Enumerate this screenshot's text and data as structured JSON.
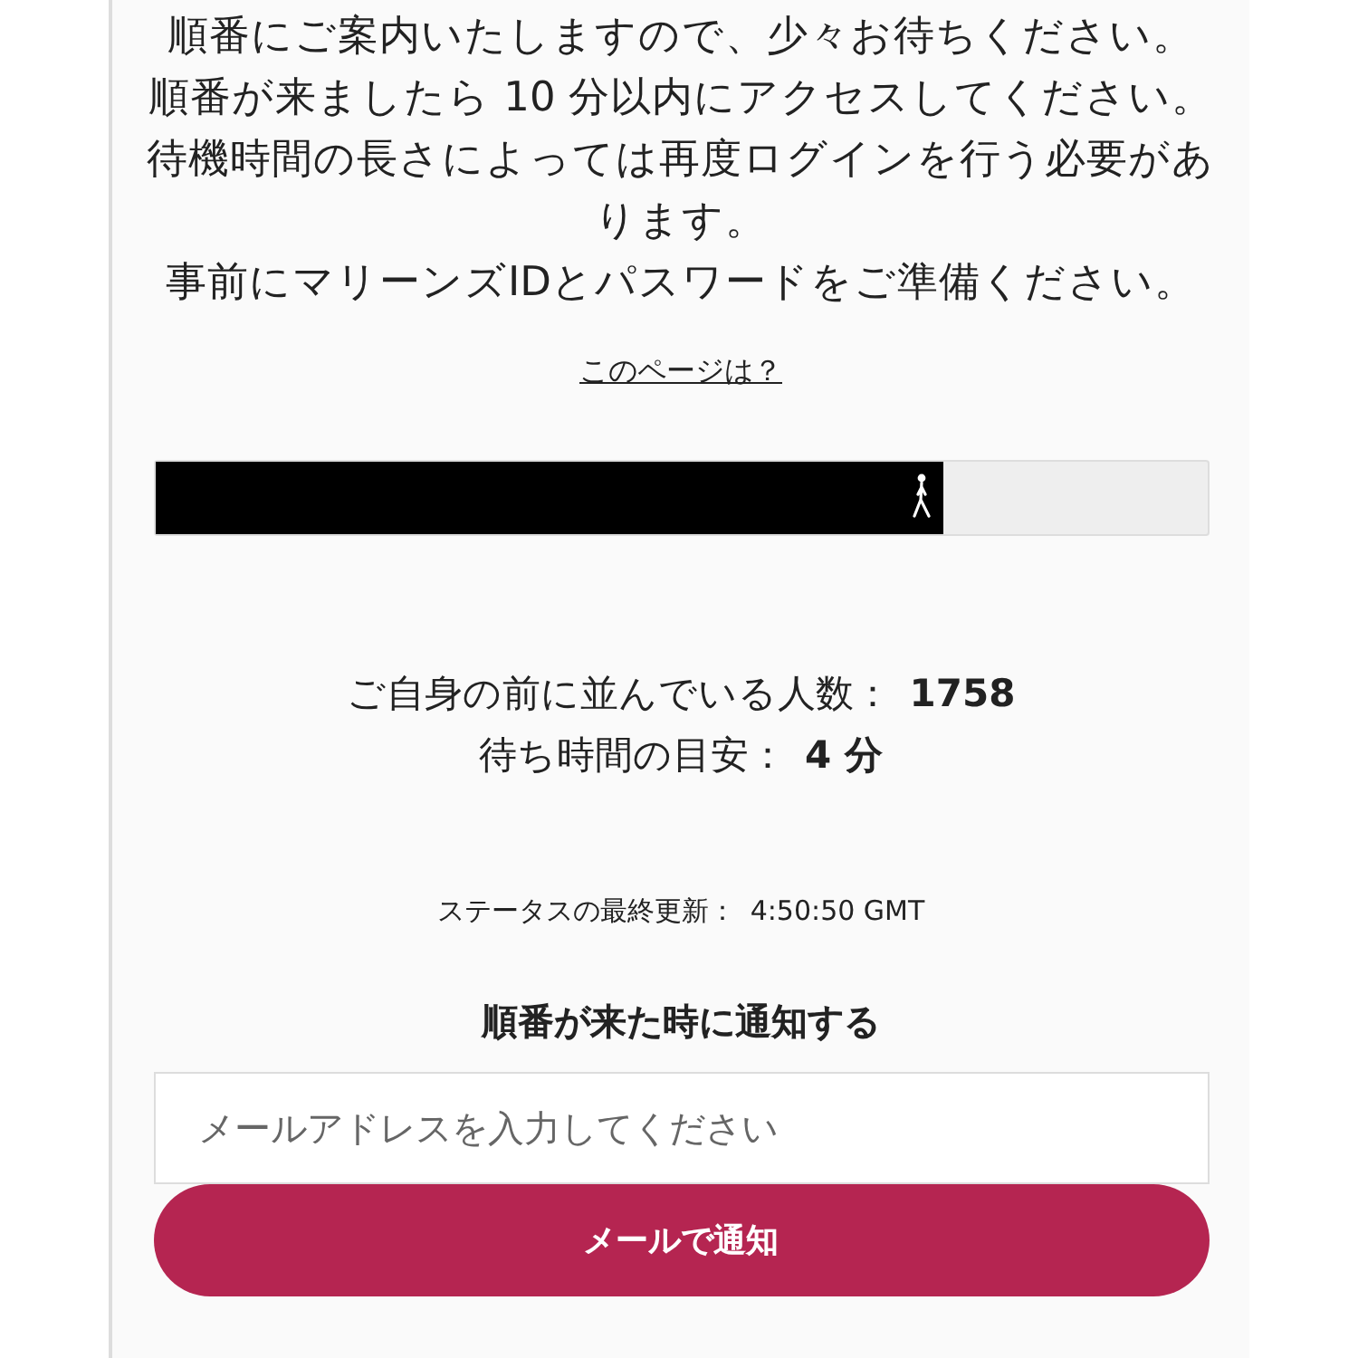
{
  "notice_lines": [
    "順番にご案内いたしますので、少々お待ちください。",
    "順番が来ましたら 10 分以内にアクセスしてください。",
    "待機時間の長さによっては再度ログインを行う必要があります。",
    "事前にマリーンズIDとパスワードをご準備ください。"
  ],
  "help_link": "このページは？",
  "progress": {
    "level": 0.75
  },
  "stats": [
    {
      "label": "ご自身の前に並んでいる人数：",
      "value": "1758"
    },
    {
      "label": "待ち時間の目安：",
      "value": "4 分"
    }
  ],
  "status": {
    "label": "ステータスの最終更新：",
    "value": "4:50:50 GMT"
  },
  "notify": {
    "heading": "順番が来た時に通知する",
    "email": {
      "placeholder": "メールアドレスを入力してください"
    },
    "button": "メールで通知"
  }
}
